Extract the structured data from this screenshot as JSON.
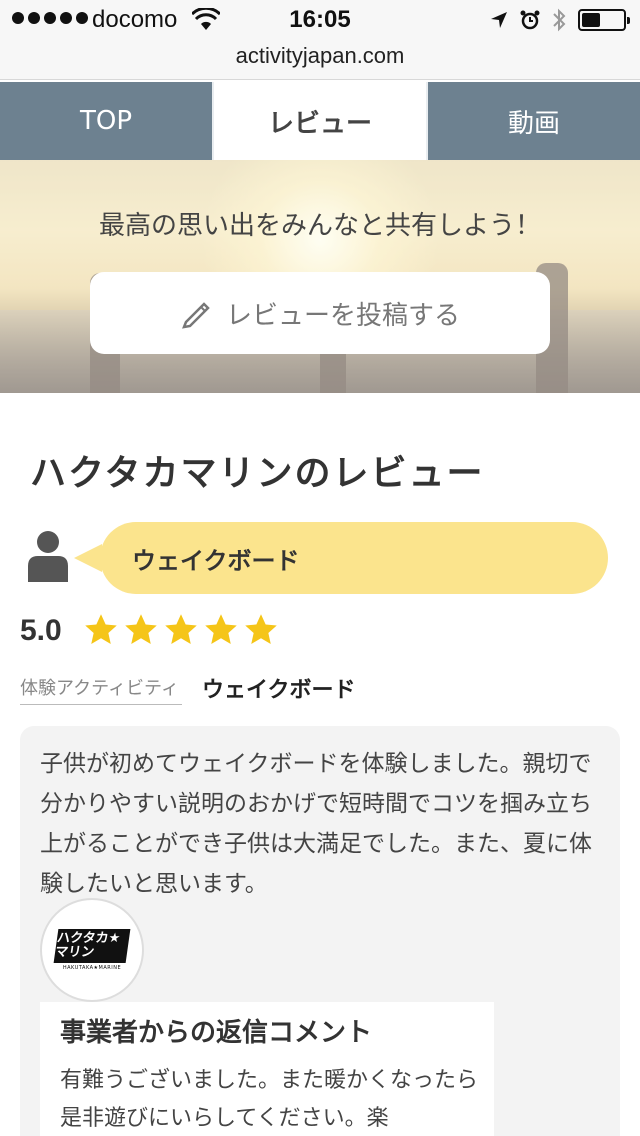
{
  "status_bar": {
    "carrier": "docomo",
    "time": "16:05",
    "battery_level": 0.45
  },
  "url_bar": {
    "url": "activityjapan.com"
  },
  "tabs": [
    {
      "label": "TOP",
      "active": false
    },
    {
      "label": "レビュー",
      "active": true
    },
    {
      "label": "動画",
      "active": false
    }
  ],
  "hero": {
    "title": "最高の思い出をみんなと共有しよう！",
    "post_button_label": "レビューを投稿する"
  },
  "page_title": "ハクタカマリンのレビュー",
  "review": {
    "activity_bubble": "ウェイクボード",
    "rating": "5.0",
    "stars": 5,
    "activity_label": "体験アクティビティ",
    "activity_value": "ウェイクボード",
    "body": "子供が初めてウェイクボードを体験しました。親切で分かりやすい説明のおかげで短時間でコツを掴み立ち上がることができ子供は大満足でした。また、夏に体験したいと思います。",
    "provider_logo_text": "ハクタカ★マリン",
    "provider_logo_sub": "HAKUTAKA★MARINE",
    "reply_title": "事業者からの返信コメント",
    "reply_body": "有難うございました。また暖かくなったら是非遊びにいらしてください。楽"
  },
  "colors": {
    "tab_bg": "#6d8190",
    "bubble": "#fbe48d",
    "star": "#f5c518"
  }
}
